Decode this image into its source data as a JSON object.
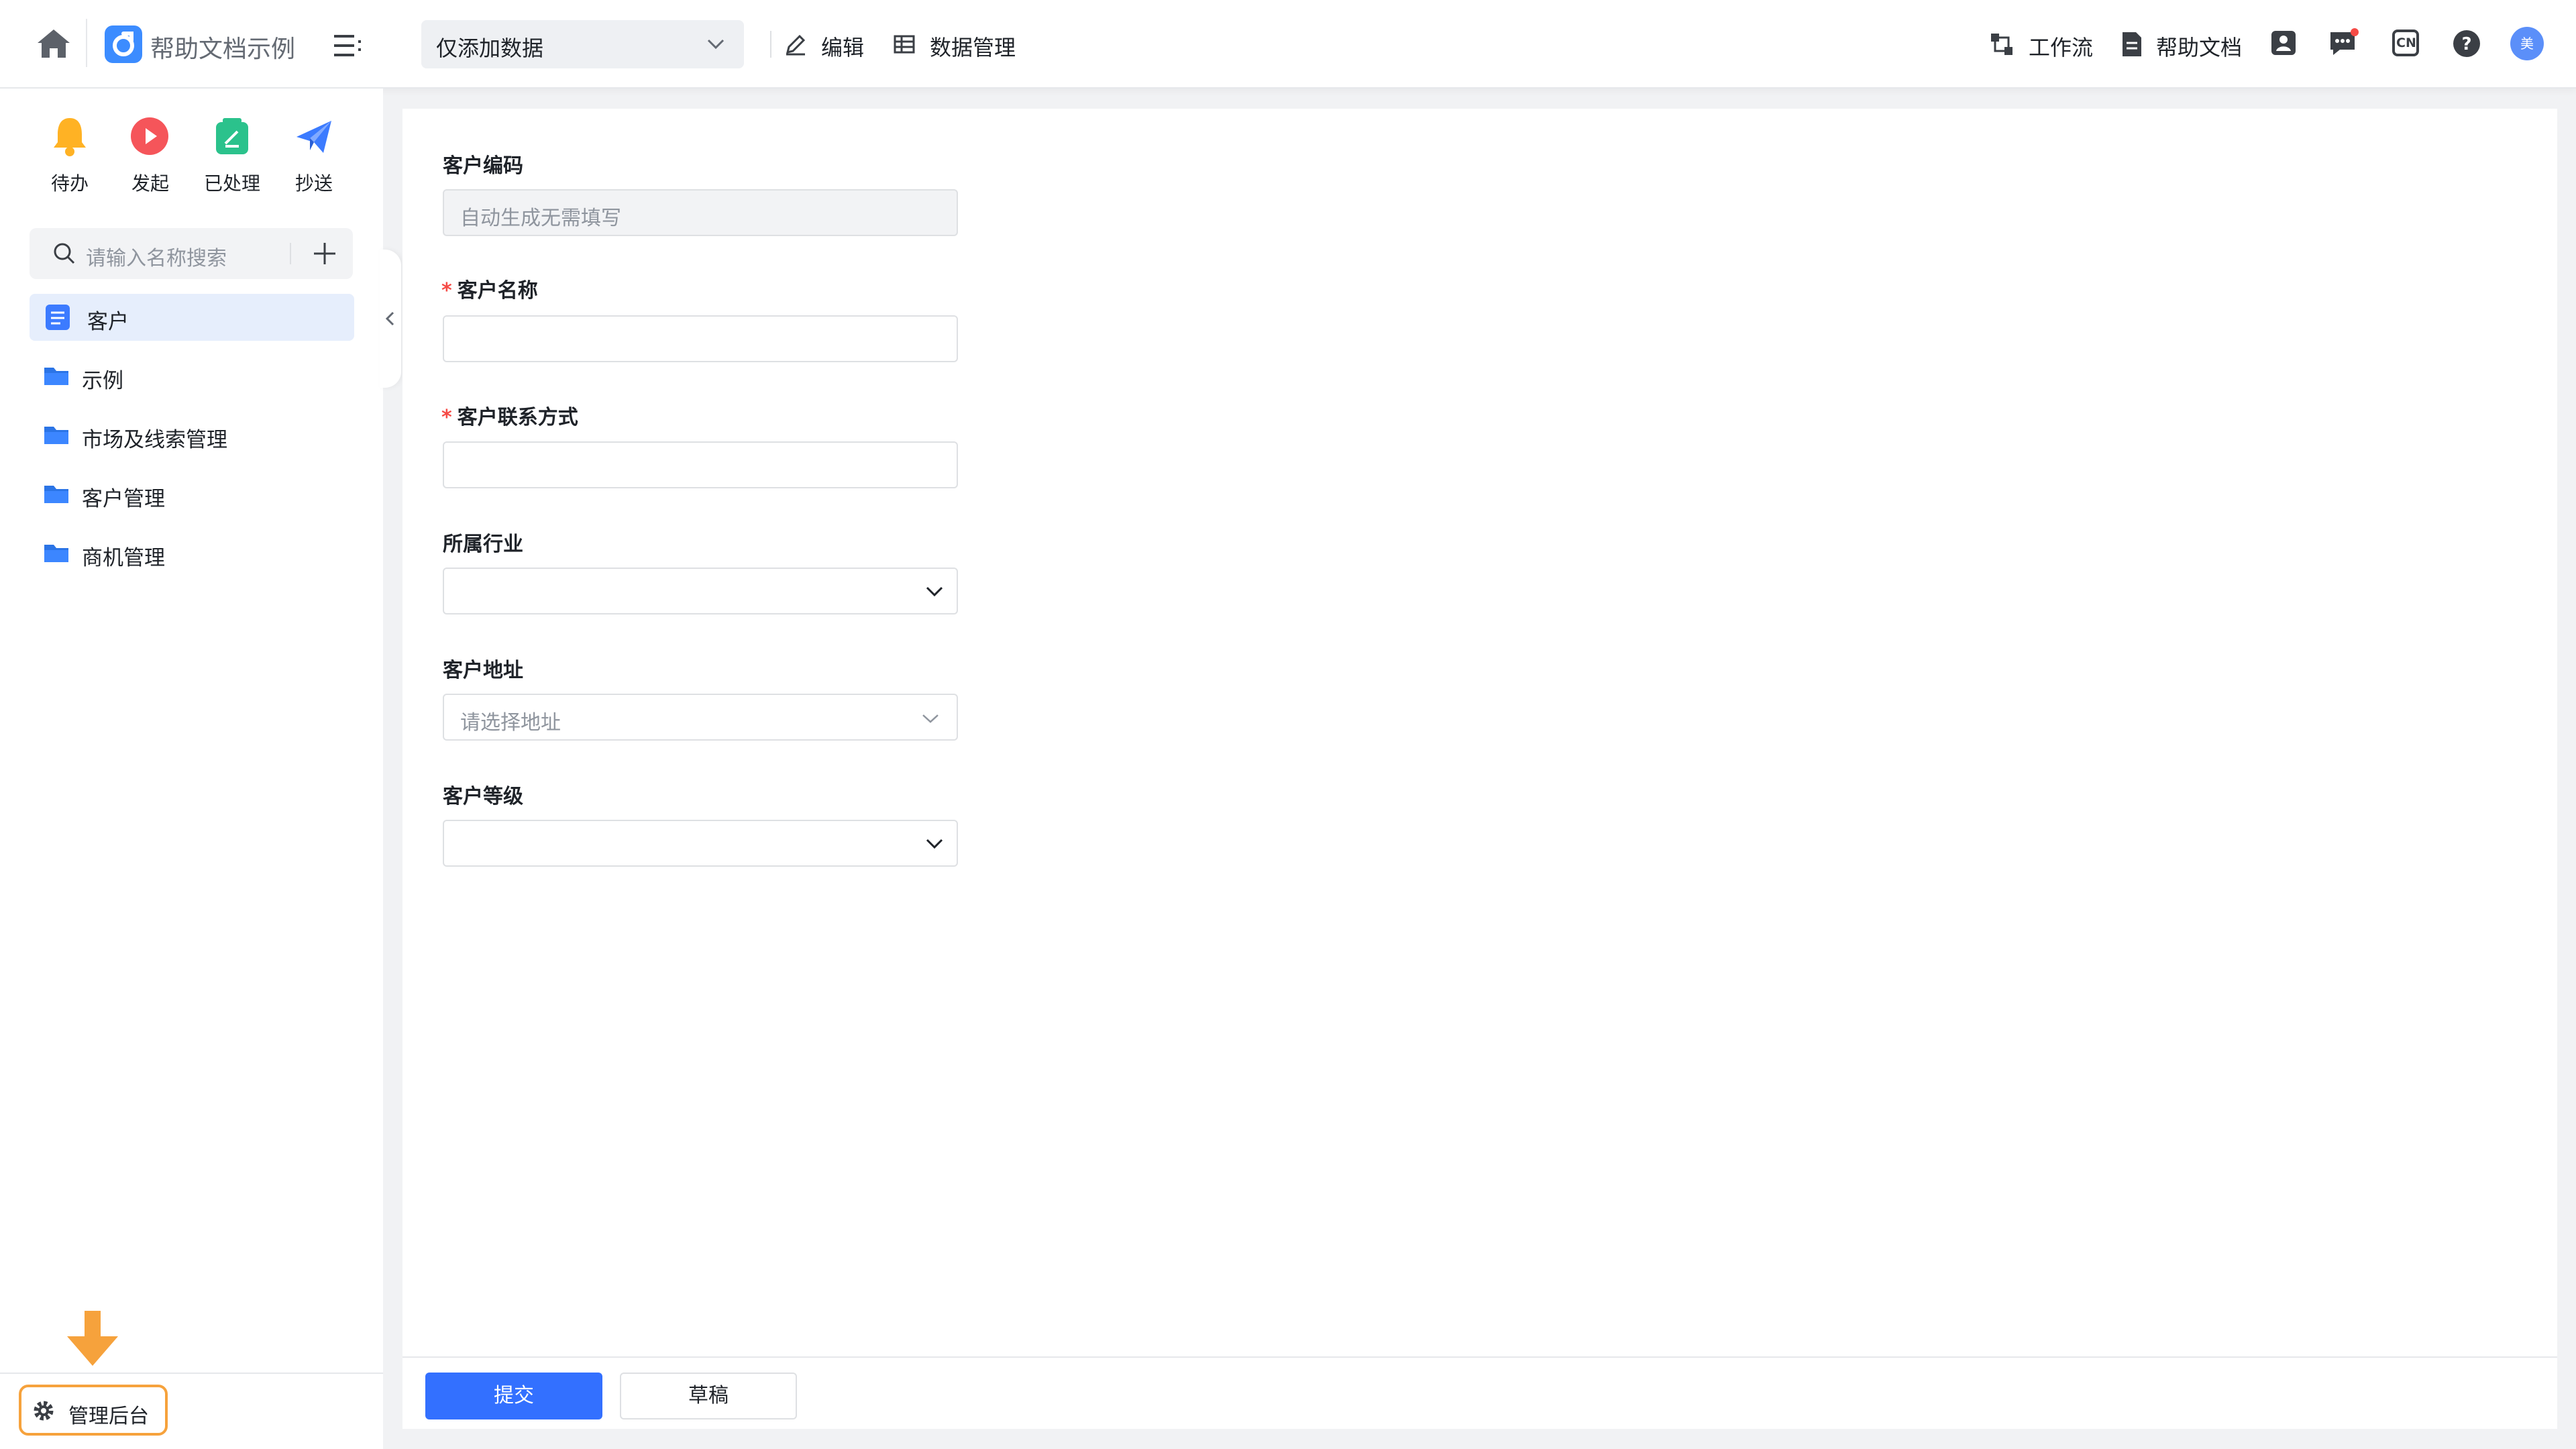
{
  "header": {
    "app_title": "帮助文档示例",
    "mode_select": "仅添加数据",
    "edit_label": "编辑",
    "data_manage_label": "数据管理",
    "workflow_label": "工作流",
    "help_docs_label": "帮助文档",
    "lang_label": "CN",
    "avatar_text": "美",
    "accent_color": "#3370ff"
  },
  "sidebar": {
    "quick_actions": [
      {
        "label": "待办",
        "icon": "bell-icon",
        "color": "#ffb224"
      },
      {
        "label": "发起",
        "icon": "play-icon",
        "color": "#f5555a"
      },
      {
        "label": "已处理",
        "icon": "done-icon",
        "color": "#2bc28c"
      },
      {
        "label": "抄送",
        "icon": "paper-plane-icon",
        "color": "#3c7bff"
      }
    ],
    "search_placeholder": "请输入名称搜索",
    "items": [
      {
        "label": "客户",
        "type": "form",
        "active": true
      },
      {
        "label": "示例",
        "type": "folder"
      },
      {
        "label": "市场及线索管理",
        "type": "folder"
      },
      {
        "label": "客户管理",
        "type": "folder"
      },
      {
        "label": "商机管理",
        "type": "folder"
      }
    ],
    "admin_label": "管理后台"
  },
  "form": {
    "fields": [
      {
        "label": "客户编码",
        "required": false,
        "placeholder": "自动生成无需填写",
        "kind": "text-disabled"
      },
      {
        "label": "客户名称",
        "required": true,
        "placeholder": "",
        "kind": "text"
      },
      {
        "label": "客户联系方式",
        "required": true,
        "placeholder": "",
        "kind": "text"
      },
      {
        "label": "所属行业",
        "required": false,
        "placeholder": "",
        "kind": "select"
      },
      {
        "label": "客户地址",
        "required": false,
        "placeholder": "请选择地址",
        "kind": "select"
      },
      {
        "label": "客户等级",
        "required": false,
        "placeholder": "",
        "kind": "select"
      }
    ],
    "required_mark": "*",
    "submit_label": "提交",
    "draft_label": "草稿"
  }
}
